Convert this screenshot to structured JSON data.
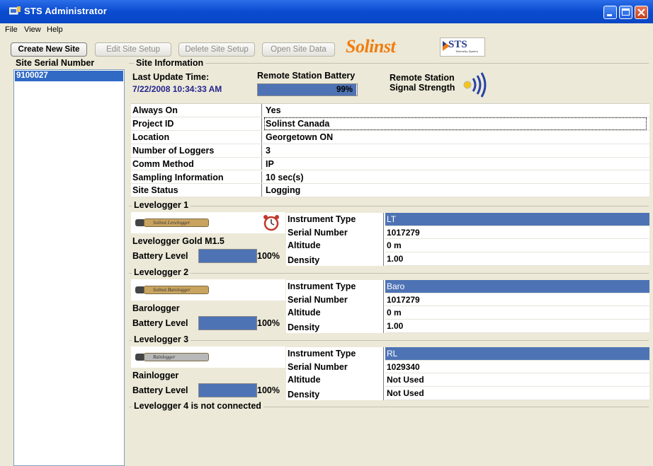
{
  "window": {
    "title": "STS Administrator"
  },
  "menu": [
    "File",
    "View",
    "Help"
  ],
  "toolbar": {
    "create": "Create New Site",
    "edit": "Edit Site Setup",
    "delete": "Delete Site Setup",
    "open": "Open Site Data",
    "logo_text": "Solinst",
    "sts_logo_text": "STS",
    "sts_logo_sub": "Telemetry System"
  },
  "site_list": {
    "header": "Site Serial Number",
    "items": [
      "9100027"
    ]
  },
  "site_info": {
    "title": "Site Information",
    "last_update_label": "Last Update Time:",
    "last_update_value": "7/22/2008 10:34:33 AM",
    "battery_label": "Remote Station Battery",
    "battery_percent": 99,
    "battery_text": "99%",
    "signal_label_1": "Remote Station",
    "signal_label_2": "Signal Strength",
    "rows": [
      {
        "key": "Always On",
        "value": "Yes"
      },
      {
        "key": "Project ID",
        "value": "Solinst Canada"
      },
      {
        "key": "Location",
        "value": "Georgetown ON"
      },
      {
        "key": "Number of Loggers",
        "value": "3"
      },
      {
        "key": "Comm Method",
        "value": "IP"
      },
      {
        "key": "Sampling Information",
        "value": "10 sec(s)"
      },
      {
        "key": "Site Status",
        "value": "Logging"
      }
    ]
  },
  "loggers": [
    {
      "title": "Levelogger 1",
      "name": "Levelogger Gold M1.5",
      "probe_label": "Solinst Levelogger",
      "battery_label": "Battery Level",
      "battery_percent": 100,
      "battery_text": "100%",
      "has_alarm": true,
      "rows": [
        {
          "key": "Instrument Type",
          "value": "LT"
        },
        {
          "key": "Serial Number",
          "value": "1017279"
        },
        {
          "key": "Altitude",
          "value": "0 m"
        },
        {
          "key": "Density",
          "value": "1.00"
        }
      ]
    },
    {
      "title": "Levelogger 2",
      "name": "Barologger",
      "probe_label": "Solinst Barologger",
      "battery_label": "Battery Level",
      "battery_percent": 100,
      "battery_text": "100%",
      "has_alarm": false,
      "rows": [
        {
          "key": "Instrument Type",
          "value": "Baro"
        },
        {
          "key": "Serial Number",
          "value": "1017279"
        },
        {
          "key": "Altitude",
          "value": "0 m"
        },
        {
          "key": "Density",
          "value": "1.00"
        }
      ]
    },
    {
      "title": "Levelogger 3",
      "name": "Rainlogger",
      "probe_label": "Rainlogger",
      "battery_label": "Battery Level",
      "battery_percent": 100,
      "battery_text": "100%",
      "has_alarm": false,
      "rows": [
        {
          "key": "Instrument Type",
          "value": "RL"
        },
        {
          "key": "Serial Number",
          "value": "1029340"
        },
        {
          "key": "Altitude",
          "value": "Not Used"
        },
        {
          "key": "Density",
          "value": "Not Used"
        }
      ]
    }
  ],
  "logger4_status": "Levelogger 4 is not connected",
  "colors": {
    "titlebar": "#0a4cd0",
    "selection": "#316ac5",
    "bar_fill": "#4e73b5",
    "logo_orange": "#f07d10"
  }
}
